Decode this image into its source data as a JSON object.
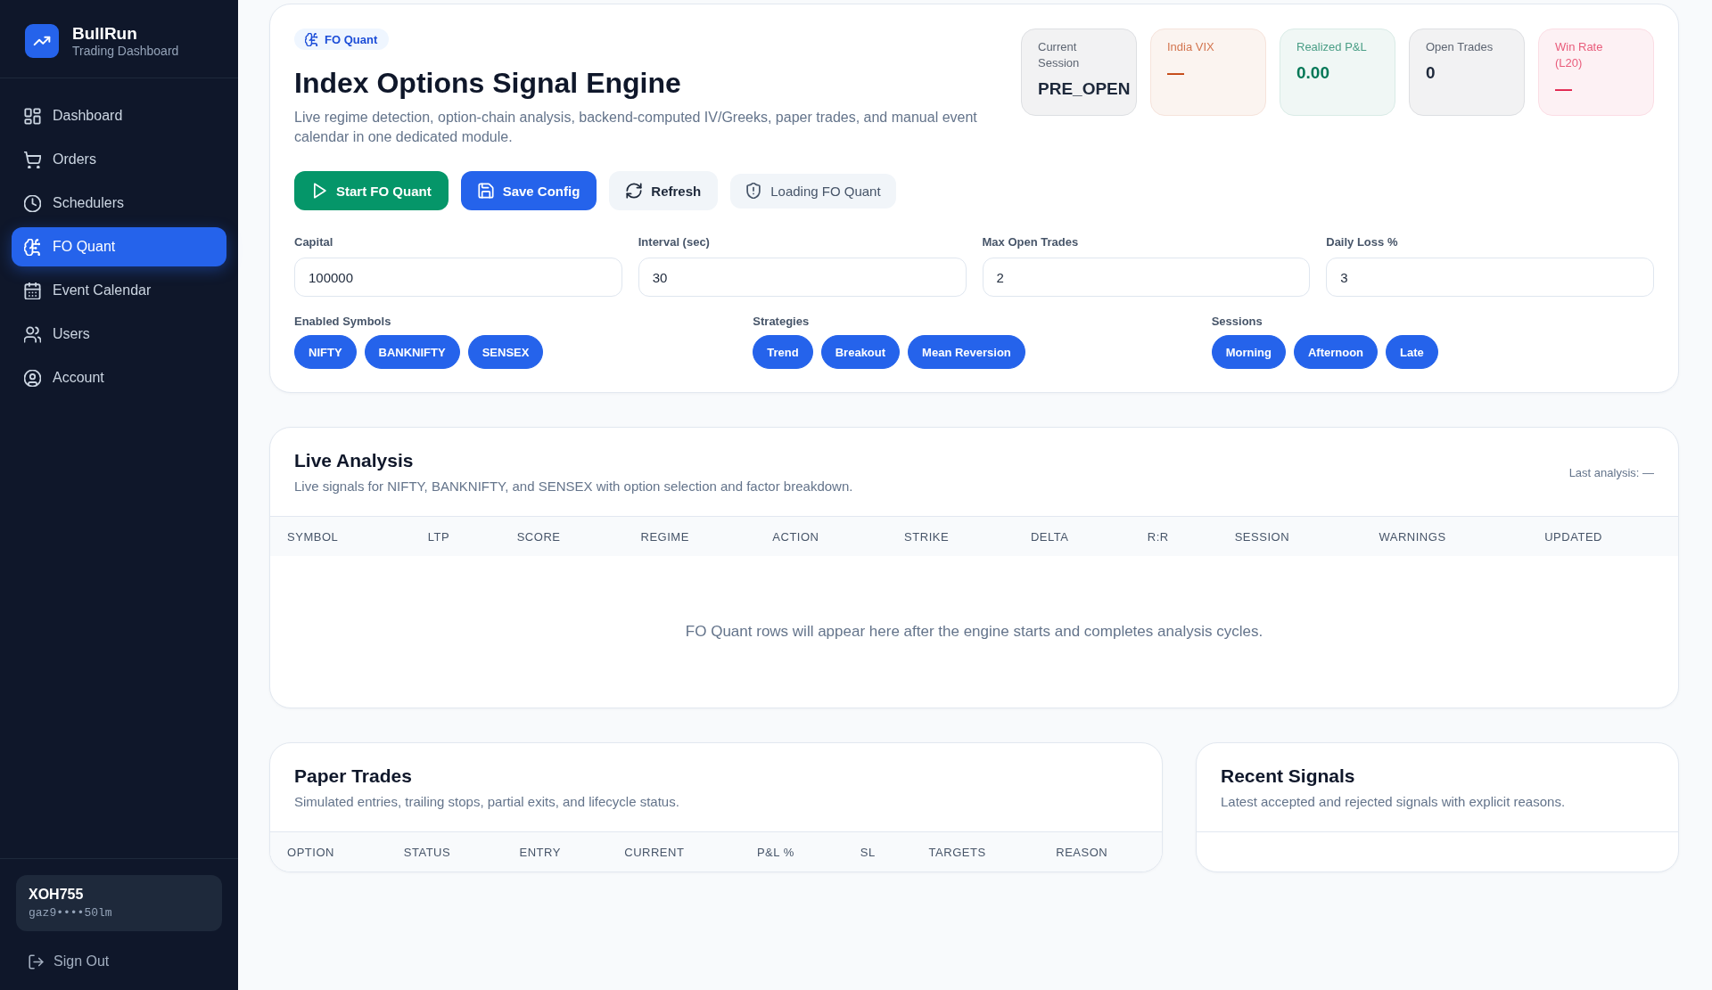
{
  "sidebar": {
    "brand": {
      "name": "BullRun",
      "tagline": "Trading Dashboard"
    },
    "items": [
      {
        "label": "Dashboard",
        "selected": false
      },
      {
        "label": "Orders",
        "selected": false
      },
      {
        "label": "Schedulers",
        "selected": false
      },
      {
        "label": "FO Quant",
        "selected": true
      },
      {
        "label": "Event Calendar",
        "selected": false
      },
      {
        "label": "Users",
        "selected": false
      },
      {
        "label": "Account",
        "selected": false
      }
    ],
    "user": {
      "name": "XOH755",
      "masked_id": "gaz9••••50lm"
    },
    "sign_out": "Sign Out"
  },
  "engine_panel": {
    "badge": "FO Quant",
    "title": "Index Options Signal Engine",
    "description": "Live regime detection, option-chain analysis, backend-computed IV/Greeks, paper trades, and manual event calendar in one dedicated module.",
    "stats": [
      {
        "label": "Current Session",
        "value": "PRE_OPEN",
        "color": "#1e293b"
      },
      {
        "label": "India VIX",
        "value": "—",
        "color": "#c2410c"
      },
      {
        "label": "Realized P&L",
        "value": "0.00",
        "color": "#047857"
      },
      {
        "label": "Open Trades",
        "value": "0",
        "color": "#1e293b"
      },
      {
        "label": "Win Rate (L20)",
        "value": "—",
        "color": "#e11d48"
      }
    ],
    "actions": [
      {
        "label": "Start FO Quant",
        "kind": "success"
      },
      {
        "label": "Save Config",
        "kind": "primary"
      },
      {
        "label": "Refresh",
        "kind": "secondary"
      },
      {
        "label": "Loading FO Quant",
        "kind": "status"
      }
    ],
    "fields": [
      {
        "label": "Capital",
        "value": "100000"
      },
      {
        "label": "Interval (sec)",
        "value": "30"
      },
      {
        "label": "Max Open Trades",
        "value": "2"
      },
      {
        "label": "Daily Loss %",
        "value": "3"
      }
    ],
    "chip_groups": [
      {
        "label": "Enabled Symbols",
        "chips": [
          {
            "label": "NIFTY",
            "selected": true
          },
          {
            "label": "BANKNIFTY",
            "selected": true
          },
          {
            "label": "SENSEX",
            "selected": true
          }
        ]
      },
      {
        "label": "Strategies",
        "chips": [
          {
            "label": "Trend",
            "selected": true
          },
          {
            "label": "Breakout",
            "selected": true
          },
          {
            "label": "Mean Reversion",
            "selected": true
          }
        ]
      },
      {
        "label": "Sessions",
        "chips": [
          {
            "label": "Morning",
            "selected": true
          },
          {
            "label": "Afternoon",
            "selected": true
          },
          {
            "label": "Late",
            "selected": true
          }
        ]
      }
    ]
  },
  "live_analysis": {
    "title": "Live Analysis",
    "subtitle": "Live signals for NIFTY, BANKNIFTY, and SENSEX with option selection and factor breakdown.",
    "last_analysis": "Last analysis: —",
    "columns": [
      "SYMBOL",
      "LTP",
      "SCORE",
      "REGIME",
      "ACTION",
      "STRIKE",
      "DELTA",
      "R:R",
      "SESSION",
      "WARNINGS",
      "UPDATED"
    ],
    "empty_message": "FO Quant rows will appear here after the engine starts and completes analysis cycles."
  },
  "paper_trades": {
    "title": "Paper Trades",
    "subtitle": "Simulated entries, trailing stops, partial exits, and lifecycle status.",
    "columns": [
      "OPTION",
      "STATUS",
      "ENTRY",
      "CURRENT",
      "P&L %",
      "SL",
      "TARGETS",
      "REASON"
    ]
  },
  "recent_signals": {
    "title": "Recent Signals",
    "subtitle": "Latest accepted and rejected signals with explicit reasons."
  }
}
